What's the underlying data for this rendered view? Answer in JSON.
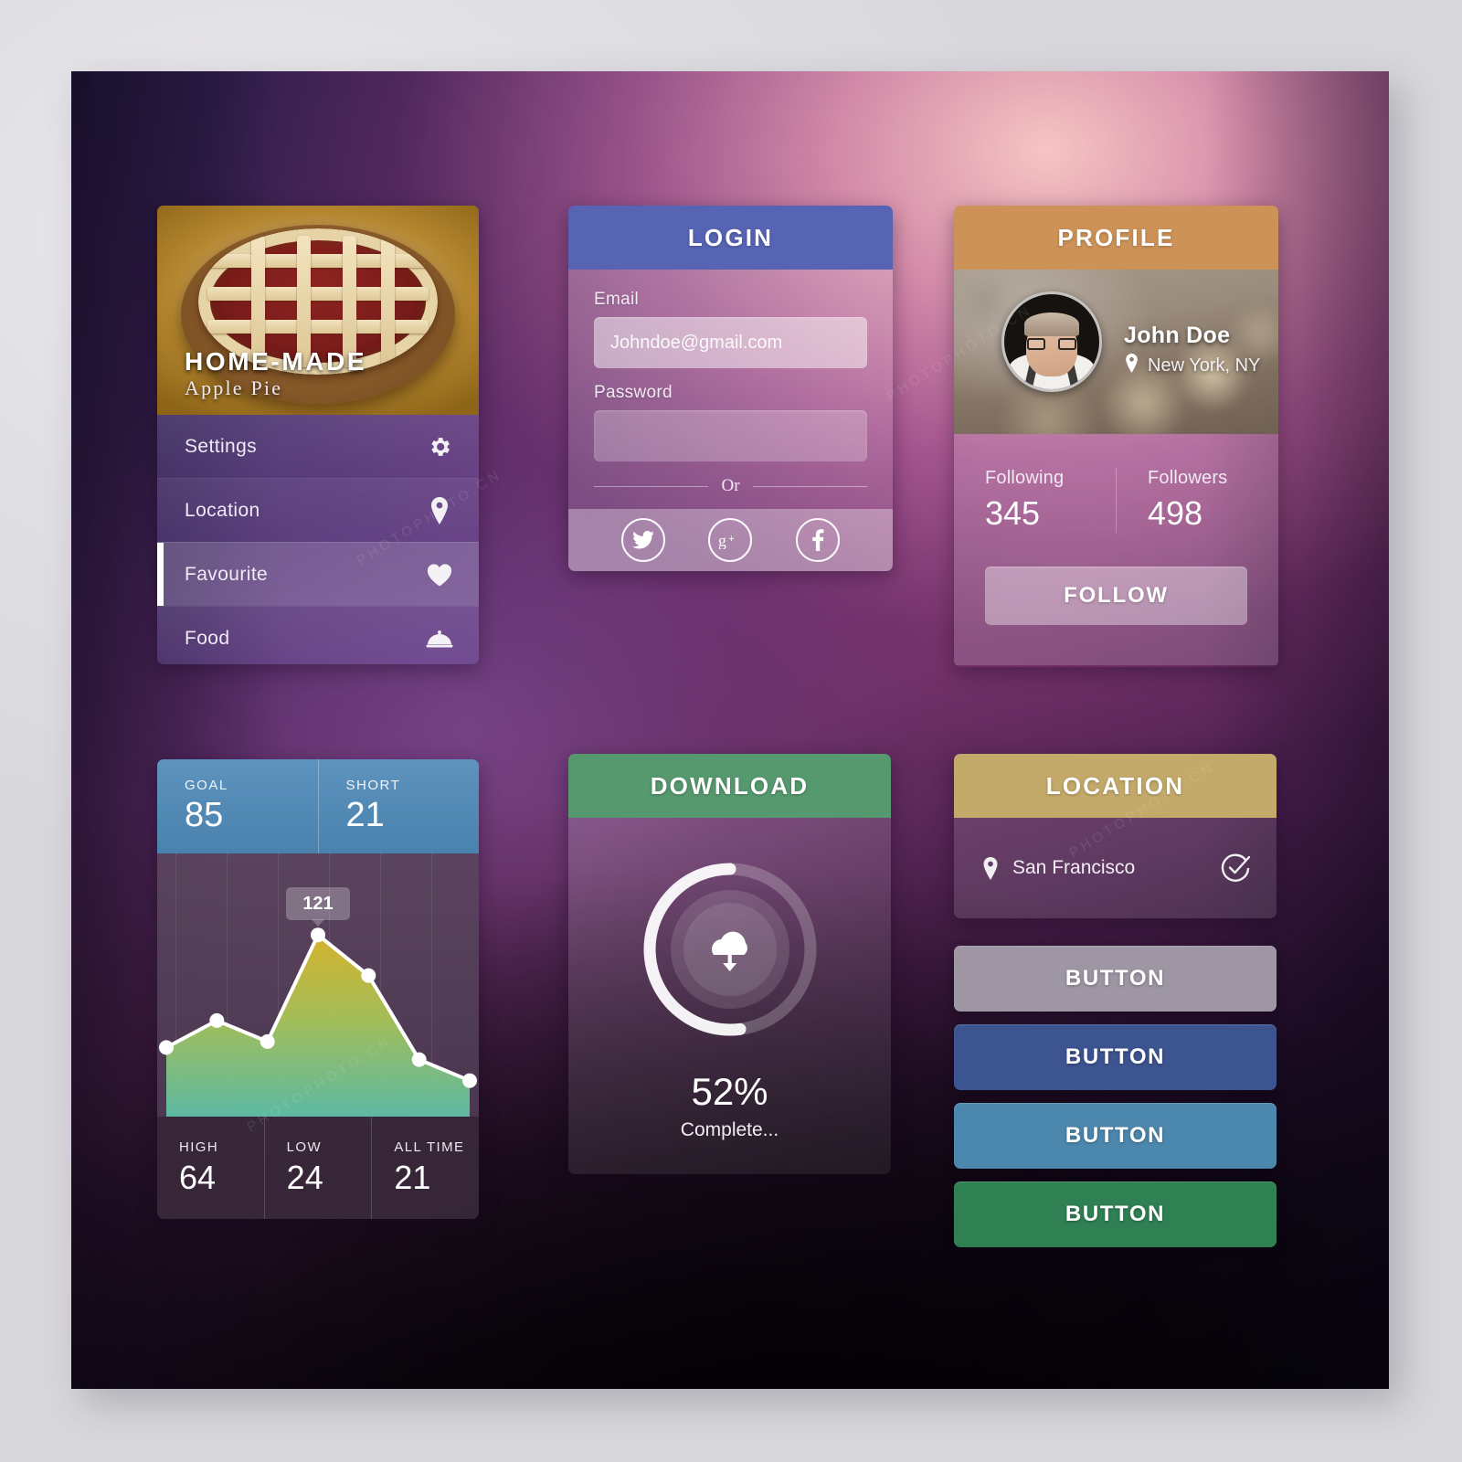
{
  "menu_card": {
    "photo": {
      "title": "HOME-MADE",
      "subtitle": "Apple Pie"
    },
    "items": [
      {
        "label": "Settings",
        "icon": "gear-icon",
        "active": false
      },
      {
        "label": "Location",
        "icon": "map-pin-icon",
        "active": false
      },
      {
        "label": "Favourite",
        "icon": "heart-icon",
        "active": true
      },
      {
        "label": "Food",
        "icon": "cloche-icon",
        "active": false
      }
    ]
  },
  "login_card": {
    "title": "LOGIN",
    "email_label": "Email",
    "email_value": "Johndoe@gmail.com",
    "password_label": "Password",
    "password_value": "",
    "divider_text": "Or",
    "social": [
      {
        "name": "twitter-icon"
      },
      {
        "name": "google-plus-icon"
      },
      {
        "name": "facebook-icon"
      }
    ],
    "header_color": "#5764b4"
  },
  "profile_card": {
    "title": "PROFILE",
    "name": "John Doe",
    "location": "New York, NY",
    "stats": [
      {
        "key": "Following",
        "value": "345"
      },
      {
        "key": "Followers",
        "value": "498"
      }
    ],
    "follow_label": "FOLLOW",
    "header_color": "#cd9257"
  },
  "chart_card": {
    "top_stats": [
      {
        "key": "GOAL",
        "value": "85"
      },
      {
        "key": "SHORT",
        "value": "21"
      }
    ],
    "bottom_stats": [
      {
        "key": "HIGH",
        "value": "64"
      },
      {
        "key": "LOW",
        "value": "24"
      },
      {
        "key": "ALL TIME",
        "value": "21"
      }
    ],
    "tooltip": "121",
    "header_color": "#4a82ae"
  },
  "download_card": {
    "title": "DOWNLOAD",
    "percent_label": "52%",
    "status": "Complete...",
    "icon": "cloud-download-icon",
    "header_color": "#56996f",
    "progress": 52
  },
  "location_card": {
    "title": "LOCATION",
    "city": "San Francisco",
    "pin_icon": "map-pin-icon",
    "check_icon": "check-circle-icon",
    "header_color": "#c3a96a"
  },
  "buttons": [
    {
      "label": "BUTTON",
      "color": "#9e96a3"
    },
    {
      "label": "BUTTON",
      "color": "#3c5490"
    },
    {
      "label": "BUTTON",
      "color": "#4c87ad"
    },
    {
      "label": "BUTTON",
      "color": "#2f8053"
    }
  ],
  "chart_data": {
    "type": "area",
    "title": "",
    "xlabel": "",
    "ylabel": "",
    "x": [
      0,
      1,
      2,
      3,
      4,
      5,
      6
    ],
    "values": [
      46,
      64,
      50,
      121,
      94,
      38,
      24
    ],
    "labeled_point": {
      "x": 3,
      "value": 121
    },
    "ylim": [
      0,
      140
    ],
    "grid": true,
    "legend": "none",
    "annotations": [
      "121"
    ]
  }
}
